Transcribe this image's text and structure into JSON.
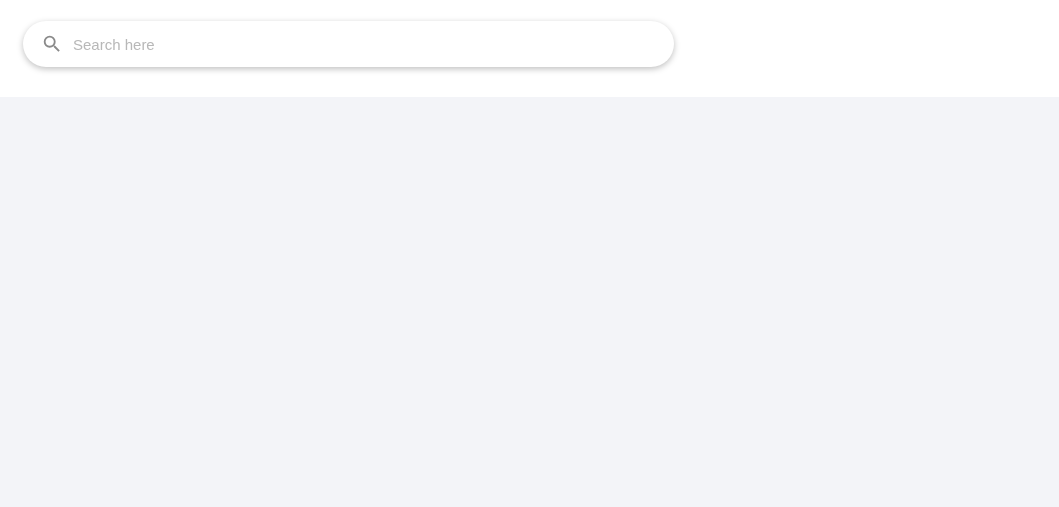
{
  "search": {
    "placeholder": "Search here"
  }
}
